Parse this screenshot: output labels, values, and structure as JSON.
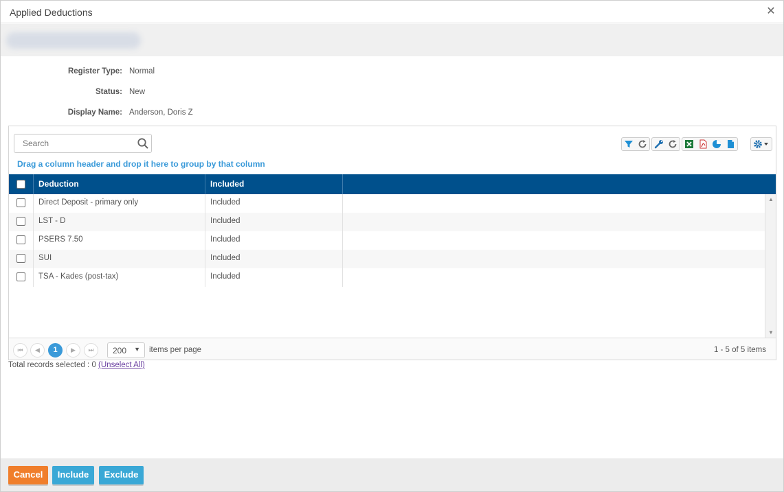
{
  "dialog": {
    "title": "Applied Deductions"
  },
  "fields": {
    "register_type": {
      "label": "Register Type:",
      "value": "Normal"
    },
    "status": {
      "label": "Status:",
      "value": "New"
    },
    "display_name": {
      "label": "Display Name:",
      "value": "Anderson, Doris Z"
    }
  },
  "search": {
    "placeholder": "Search"
  },
  "grid": {
    "group_hint": "Drag a column header and drop it here to group by that column",
    "columns": [
      "Deduction",
      "Included"
    ],
    "rows": [
      {
        "deduction": "Direct Deposit - primary only",
        "included": "Included"
      },
      {
        "deduction": "LST - D",
        "included": "Included"
      },
      {
        "deduction": "PSERS 7.50",
        "included": "Included"
      },
      {
        "deduction": "SUI",
        "included": "Included"
      },
      {
        "deduction": "TSA - Kades (post-tax)",
        "included": "Included"
      }
    ]
  },
  "pager": {
    "current_page": "1",
    "page_size": "200",
    "items_per_page": "items per page",
    "count": "1 - 5 of 5 items"
  },
  "total": {
    "text": "Total records selected : 0",
    "unselect": "(Unselect All)"
  },
  "footer": {
    "cancel": "Cancel",
    "include": "Include",
    "exclude": "Exclude"
  },
  "colors": {
    "header": "#00508c",
    "accent": "#3a9ad9",
    "cancel": "#f07e2b"
  }
}
